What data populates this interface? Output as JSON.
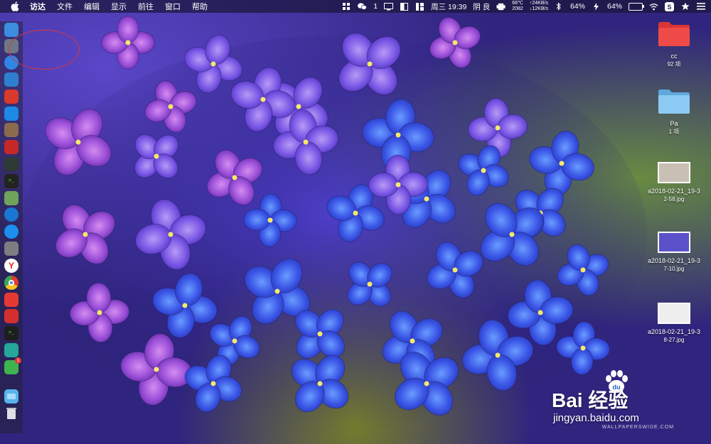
{
  "menubar": {
    "apple_icon": "apple-logo-icon",
    "items": [
      "访达",
      "文件",
      "编辑",
      "显示",
      "前往",
      "窗口",
      "帮助"
    ],
    "status": {
      "wechat_count": "1",
      "datetime": "周三 19:39",
      "weather": "阴 良",
      "temp": "68℃",
      "fan": "2082",
      "net_up": "↑24KB/s",
      "net_down": "↓12KB/s",
      "battery_1": "64%",
      "battery_2": "64%",
      "battery_level": 0.64
    }
  },
  "dock": {
    "items": [
      {
        "name": "finder",
        "color": "#3c8de0"
      },
      {
        "name": "launchpad",
        "color": "#6d7886"
      },
      {
        "name": "safari",
        "color": "#2f86e4"
      },
      {
        "name": "contacts",
        "color": "#2f7fd0"
      },
      {
        "name": "app-red",
        "color": "#d93a2b"
      },
      {
        "name": "app-blue",
        "color": "#1e88e5"
      },
      {
        "name": "app-brown",
        "color": "#8a6b4e"
      },
      {
        "name": "app-red-2",
        "color": "#c62828"
      },
      {
        "name": "activity-monitor",
        "color": "#2d3a35"
      },
      {
        "name": "terminal",
        "color": "#222222"
      },
      {
        "name": "preview",
        "color": "#6fa35c"
      },
      {
        "name": "app-blue-2",
        "color": "#1976d2"
      },
      {
        "name": "app-store",
        "color": "#1c8ef0"
      },
      {
        "name": "system-preferences",
        "color": "#7d7d82"
      },
      {
        "name": "yandex",
        "color": "#ffffff"
      },
      {
        "name": "chrome",
        "color": "#e8e8e8"
      },
      {
        "name": "weibo",
        "color": "#e53935"
      },
      {
        "name": "vivaldi",
        "color": "#d32f2f"
      },
      {
        "name": "terminal-2",
        "color": "#1e1e1e"
      },
      {
        "name": "app-teal",
        "color": "#26a69a"
      },
      {
        "name": "wechat",
        "color": "#3fb34f",
        "badge": "1"
      },
      {
        "name": "downloads-folder",
        "color": "#58b4ea"
      },
      {
        "name": "trash",
        "color": "#c9ccd1"
      }
    ]
  },
  "desktop": {
    "icons": [
      {
        "kind": "folder-red",
        "name": "cc",
        "sub": "92 项"
      },
      {
        "kind": "folder-blue",
        "name": "Pa",
        "sub": "1 项"
      },
      {
        "kind": "thumb",
        "name": "a2018-02-21_19-3",
        "sub": "2-58.jpg",
        "color": "#c9bfb4"
      },
      {
        "kind": "thumb",
        "name": "a2018-02-21_19-3",
        "sub": "7-10.jpg",
        "color": "#5b52c9"
      },
      {
        "kind": "thumb",
        "name": "a2018-02-21_19-3",
        "sub": "8-27.jpg",
        "color": "#eeeeee"
      }
    ]
  },
  "watermark": {
    "logo": "Bai  经验",
    "url": "jingyan.baidu.com",
    "credit": "WALLPAPERSWIDE.COM"
  }
}
